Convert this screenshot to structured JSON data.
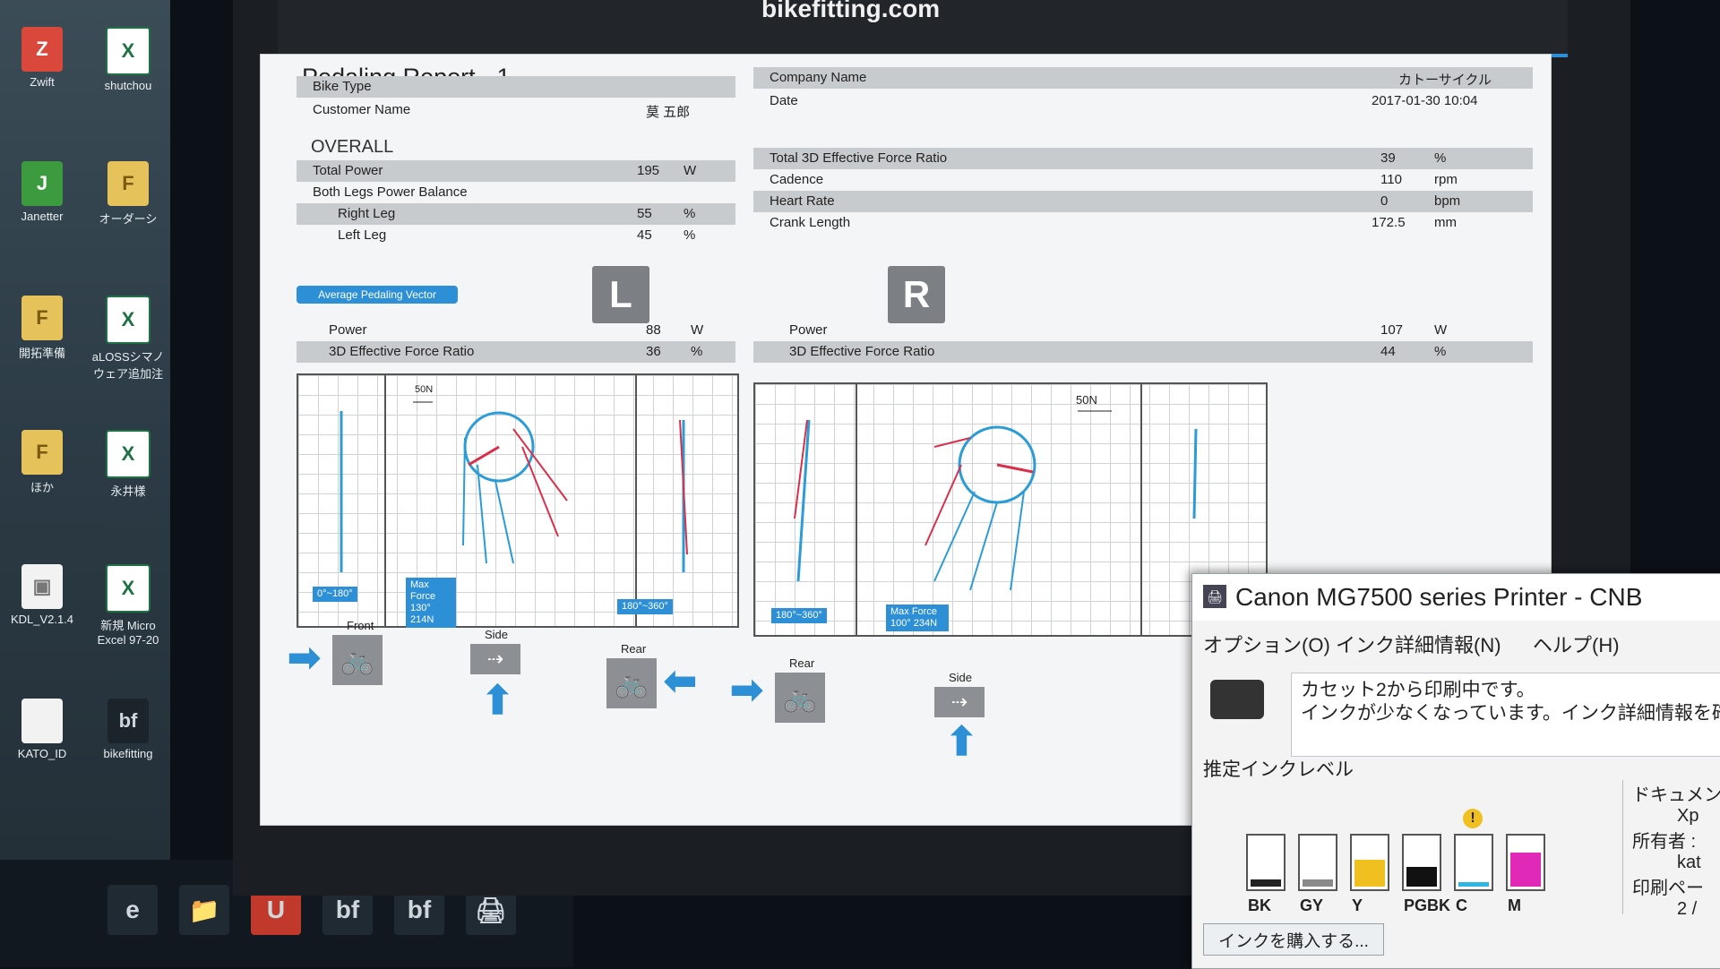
{
  "desktop": {
    "icons": [
      {
        "label": "Zwift",
        "glyph": "Z",
        "kind": "zw"
      },
      {
        "label": "shutchou",
        "glyph": "X",
        "kind": "xl"
      },
      {
        "label": "Janetter",
        "glyph": "J",
        "kind": "gn"
      },
      {
        "label": "オーダーシ",
        "glyph": "F",
        "kind": "fd"
      },
      {
        "label": "開拓準備",
        "glyph": "F",
        "kind": "fd"
      },
      {
        "label": "aLOSSシマノ ウェア追加注",
        "glyph": "X",
        "kind": "xl"
      },
      {
        "label": "ほか",
        "glyph": "F",
        "kind": "fd"
      },
      {
        "label": "永井様",
        "glyph": "X",
        "kind": "xl"
      },
      {
        "label": "KDL_V2.1.4",
        "glyph": "▣",
        "kind": "fl"
      },
      {
        "label": "新規 Micro Excel 97-20",
        "glyph": "X",
        "kind": "xl"
      },
      {
        "label": "KATO_ID",
        "glyph": "",
        "kind": "fl"
      },
      {
        "label": "bikefitting",
        "glyph": "bf",
        "kind": "bf"
      }
    ]
  },
  "taskbar": {
    "items": [
      "e",
      "📁",
      "U",
      "bf",
      "bf",
      "🖨"
    ]
  },
  "app": {
    "site": "bikefitting.com"
  },
  "report": {
    "title": "Pedaling Report - 1",
    "bike_type_label": "Bike Type",
    "customer_label": "Customer Name",
    "customer_value": "莫 五郎",
    "company_label": "Company Name",
    "company_value": "カトーサイクル",
    "date_label": "Date",
    "date_value": "2017-01-30 10:04",
    "overall": "OVERALL",
    "total_power_label": "Total Power",
    "total_power_value": "195",
    "total_power_unit": "W",
    "balance_label": "Both Legs Power Balance",
    "right_leg_label": "Right Leg",
    "right_leg_value": "55",
    "left_leg_label": "Left Leg",
    "left_leg_value": "45",
    "pct": "%",
    "t3d_label": "Total 3D Effective Force Ratio",
    "t3d_value": "39",
    "cadence_label": "Cadence",
    "cadence_value": "110",
    "cadence_unit": "rpm",
    "hr_label": "Heart Rate",
    "hr_value": "0",
    "hr_unit": "bpm",
    "crank_label": "Crank Length",
    "crank_value": "172.5",
    "crank_unit": "mm",
    "avg_btn": "Average Pedaling Vector",
    "left": {
      "badge": "L",
      "power_label": "Power",
      "power_value": "88",
      "power_unit": "W",
      "ratio_label": "3D Effective Force Ratio",
      "ratio_value": "36",
      "ratio_unit": "%",
      "scale": "50N",
      "range1": "0°~180°",
      "maxforce_title": "Max Force",
      "maxforce_value": "130° 214N",
      "range2": "180°~360°",
      "views": [
        "Front",
        "Side",
        "Rear"
      ]
    },
    "right": {
      "badge": "R",
      "power_label": "Power",
      "power_value": "107",
      "power_unit": "W",
      "ratio_label": "3D Effective Force Ratio",
      "ratio_value": "44",
      "ratio_unit": "%",
      "scale": "50N",
      "range1": "180°~360°",
      "maxforce_title": "Max Force",
      "maxforce_value": "100° 234N",
      "views": [
        "Rear",
        "Side"
      ]
    }
  },
  "printer": {
    "title": "Canon MG7500 series Printer - CNB",
    "menu": [
      "オプション(O)",
      "インク詳細情報(N)",
      "ヘルプ(H)"
    ],
    "message_line1": "カセット2から印刷中です。",
    "message_line2": "インクが少なくなっています。インク詳細情報を確認",
    "ink_level_label": "推定インクレベル",
    "inks": [
      {
        "name": "BK",
        "level": 0.15,
        "color": "#222222",
        "warn": false
      },
      {
        "name": "GY",
        "level": 0.15,
        "color": "#8a8a8a",
        "warn": false
      },
      {
        "name": "Y",
        "level": 0.55,
        "color": "#f0c020",
        "warn": false
      },
      {
        "name": "PGBK",
        "level": 0.4,
        "color": "#111111",
        "warn": false
      },
      {
        "name": "C",
        "level": 0.1,
        "color": "#2fb6e3",
        "warn": true
      },
      {
        "name": "M",
        "level": 0.7,
        "color": "#e02ab7",
        "warn": false
      }
    ],
    "warn_glyph": "!",
    "buy_button": "インクを購入する...",
    "side_doc": "ドキュメン",
    "side_doc2": "Xp",
    "side_owner": "所有者 :",
    "side_owner2": "kat",
    "side_pages": "印刷ペー",
    "side_pages2": "2 /"
  }
}
